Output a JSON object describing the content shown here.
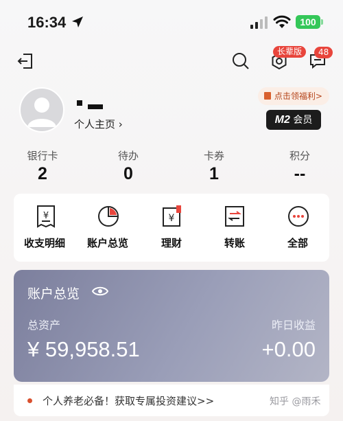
{
  "status_bar": {
    "time": "16:34",
    "battery": "100"
  },
  "header": {
    "gear_badge": "长辈版",
    "message_badge": "48"
  },
  "profile": {
    "homepage_label": "个人主页 ›",
    "welfare_label": "点击领福利>",
    "member_logo": "M2",
    "member_label": "会员"
  },
  "stats": [
    {
      "label": "银行卡",
      "value": "2"
    },
    {
      "label": "待办",
      "value": "0"
    },
    {
      "label": "卡券",
      "value": "1"
    },
    {
      "label": "积分",
      "value": "--"
    }
  ],
  "actions": [
    {
      "label": "收支明细",
      "icon": "receipt-icon"
    },
    {
      "label": "账户总览",
      "icon": "pie-chart-icon"
    },
    {
      "label": "理财",
      "icon": "wealth-icon"
    },
    {
      "label": "转账",
      "icon": "transfer-icon"
    },
    {
      "label": "全部",
      "icon": "more-icon"
    }
  ],
  "asset_card": {
    "title": "账户总览",
    "total_label": "总资产",
    "total_value": "¥ 59,958.51",
    "yesterday_label": "昨日收益",
    "yesterday_value": "+0.00"
  },
  "tip": {
    "text": "个人养老必备！获取专属投资建议>>"
  },
  "watermark": "知乎 @雨禾",
  "colors": {
    "accent_red": "#e8453c",
    "card_gradient_start": "#7c7f9d",
    "battery_green": "#34c759"
  }
}
